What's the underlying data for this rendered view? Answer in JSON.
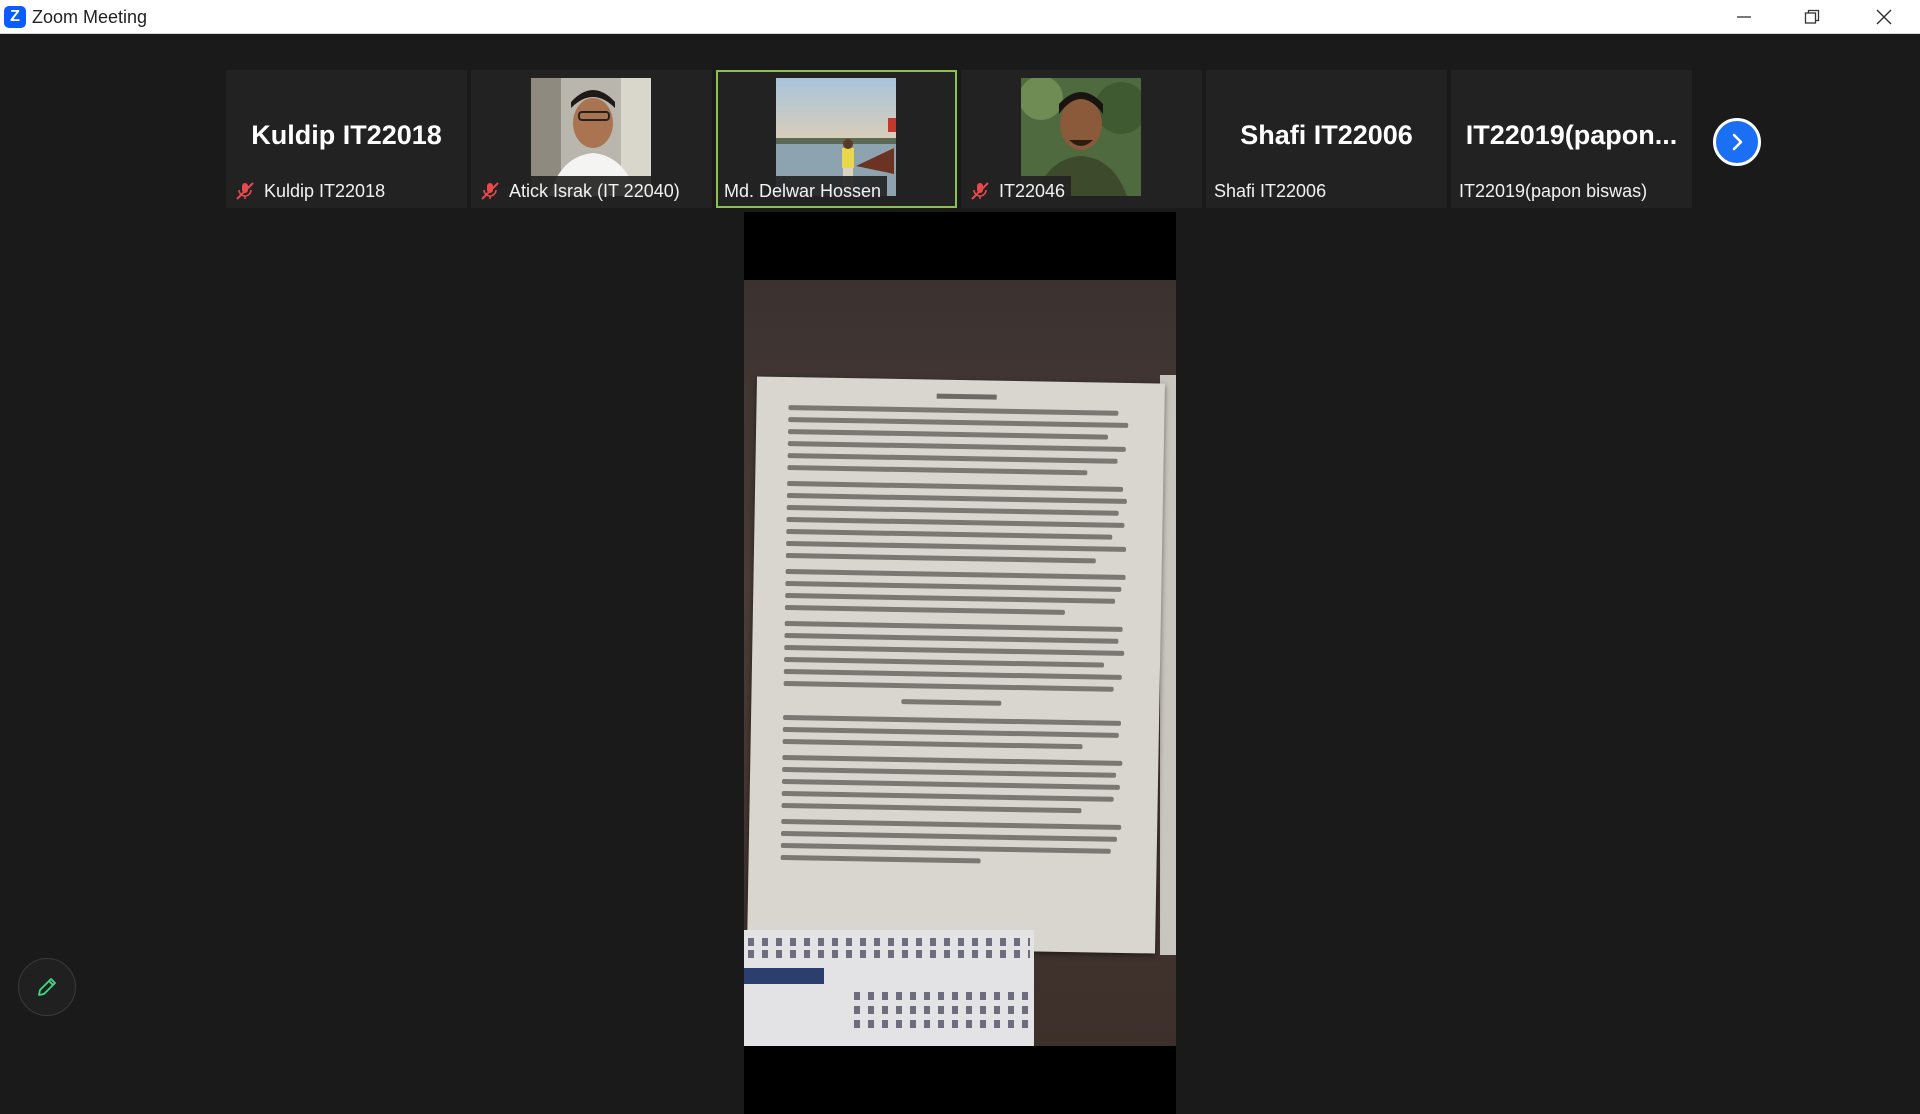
{
  "window": {
    "title": "Zoom Meeting",
    "logo_letter": "Z"
  },
  "participants": [
    {
      "display_name": "Kuldip IT22018",
      "label": "Kuldip IT22018",
      "muted": true,
      "video": false,
      "active": false
    },
    {
      "display_name": "",
      "label": "Atick Israk (IT 22040)",
      "muted": true,
      "video": true,
      "active": false
    },
    {
      "display_name": "",
      "label": "Md. Delwar Hossen",
      "muted": false,
      "video": true,
      "active": true
    },
    {
      "display_name": "",
      "label": "IT22046",
      "muted": true,
      "video": true,
      "active": false
    },
    {
      "display_name": "Shafi IT22006",
      "label": "Shafi IT22006",
      "muted": false,
      "video": false,
      "active": false
    },
    {
      "display_name": "IT22019(papon...",
      "label": "IT22019(papon biswas)",
      "muted": false,
      "video": false,
      "active": false
    }
  ],
  "colors": {
    "accent": "#1b6ff5",
    "active_border": "#8bc34a",
    "muted_icon": "#e5484d",
    "pen_icon": "#3ddc84"
  },
  "icons": {
    "minimize": "minimize-icon",
    "restore": "restore-icon",
    "close": "close-icon",
    "next": "chevron-right-icon",
    "pen": "pencil-icon",
    "mute": "mic-off-icon"
  }
}
